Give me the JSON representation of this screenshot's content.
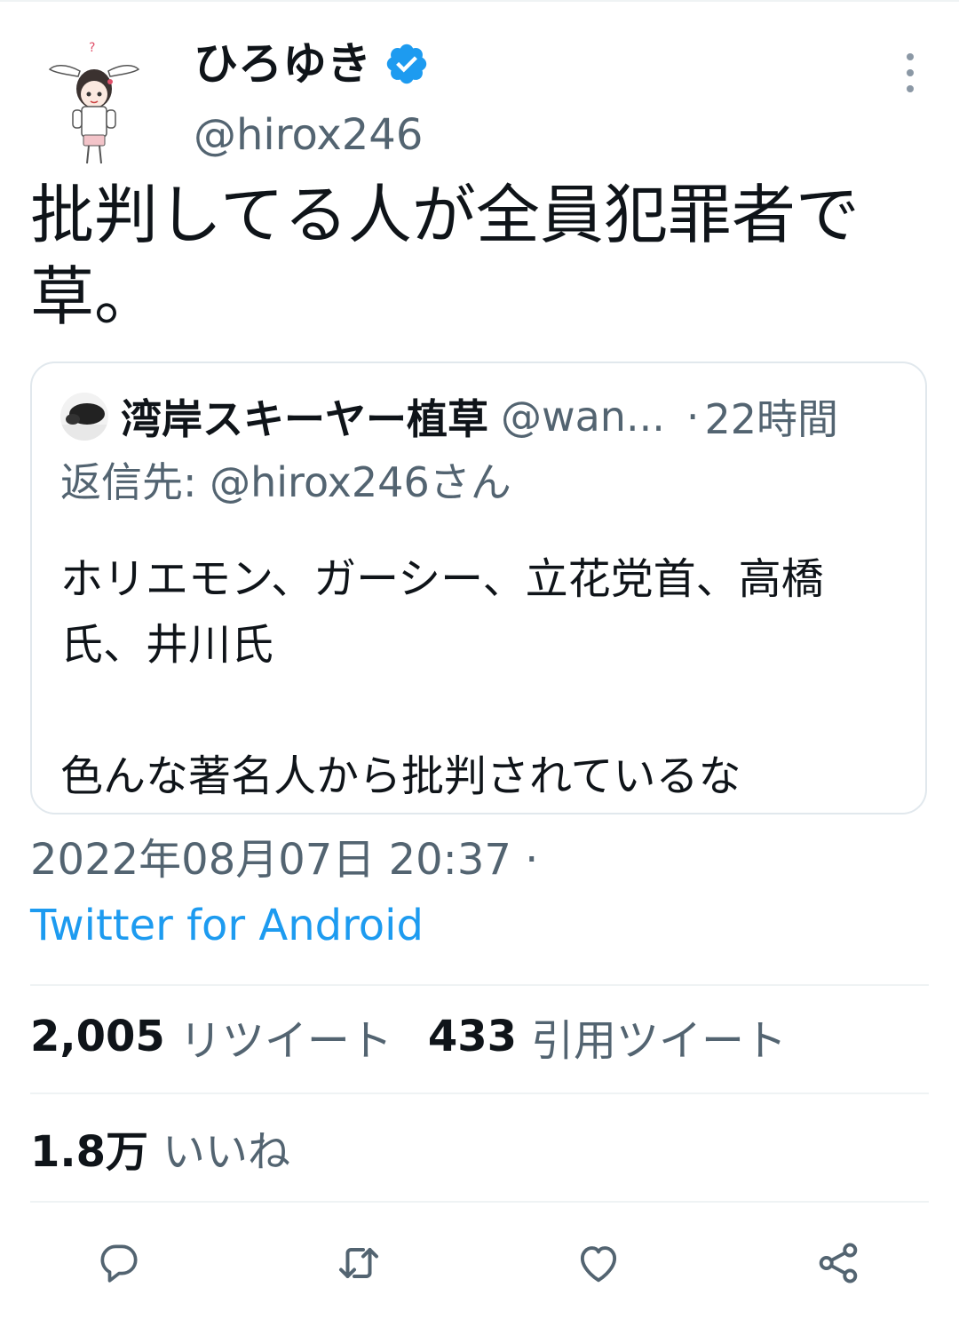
{
  "tweet": {
    "author_name": "ひろゆき",
    "author_handle": "@hirox246",
    "text": "批判してる人が全員犯罪者で草。",
    "timestamp": "2022年08月07日 20:37 ·",
    "source": "Twitter for Android"
  },
  "quoted": {
    "author_name": "湾岸スキーヤー植草",
    "author_handle": "@wan...",
    "dot": "·",
    "time": "22時間",
    "reply_to": "返信先: @hirox246さん",
    "text": "ホリエモン、ガーシー、立花党首、高橋氏、井川氏\n\n色んな著名人から批判されているな"
  },
  "stats": {
    "retweets_count": "2,005",
    "retweets_label": "リツイート",
    "quotes_count": "433",
    "quotes_label": "引用ツイート",
    "likes_count": "1.8万",
    "likes_label": "いいね"
  },
  "icons": {
    "verified": "verified-badge-icon",
    "more": "more-vertical-icon",
    "reply": "reply-icon",
    "retweet": "retweet-icon",
    "like": "heart-icon",
    "share": "share-icon"
  },
  "colors": {
    "accent": "#1d9bf0",
    "secondary_text": "#536471",
    "primary_text": "#0f1419",
    "border": "#e1e8ed"
  }
}
